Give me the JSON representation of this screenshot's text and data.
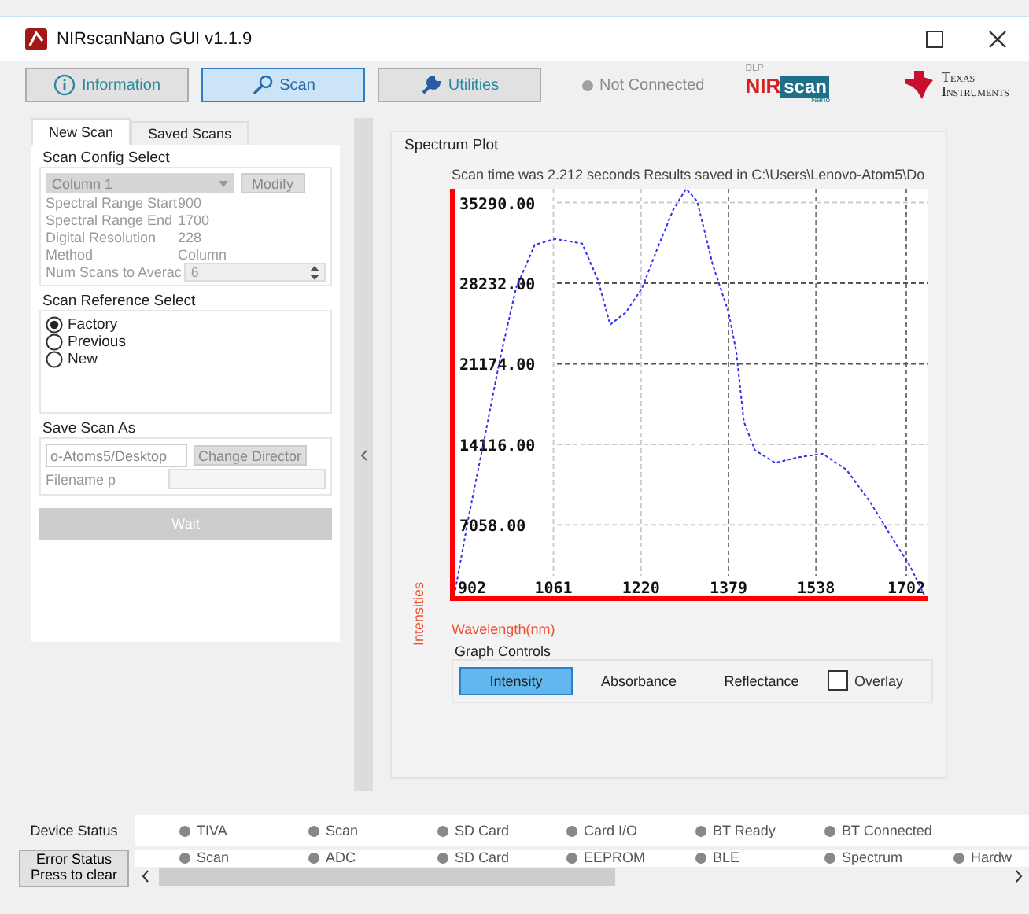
{
  "window": {
    "title": "NIRscanNano GUI v1.1.9"
  },
  "main_tabs": [
    {
      "label": "Information",
      "selected": false
    },
    {
      "label": "Scan",
      "selected": true
    },
    {
      "label": "Utilities",
      "selected": false
    }
  ],
  "connection": {
    "label": "Not Connected",
    "connected": false
  },
  "nirscan_logo": {
    "top": "DLP",
    "nir": "NIR",
    "scan": "scan",
    "sub": "Nano"
  },
  "ti_logo": {
    "line1": "Texas",
    "line2": "Instruments"
  },
  "scan_tabs": [
    {
      "label": "New Scan",
      "selected": true
    },
    {
      "label": "Saved Scans",
      "selected": false
    }
  ],
  "scan_config": {
    "title": "Scan Config Select",
    "disabled": true,
    "config": "Column 1",
    "modify": "Modify",
    "fields": [
      {
        "label": "Spectral Range Start",
        "value": "900"
      },
      {
        "label": "Spectral Range End",
        "value": "1700"
      },
      {
        "label": "Digital Resolution",
        "value": "228"
      },
      {
        "label": "Method",
        "value": "Column"
      }
    ],
    "num_scans": {
      "label": "Num Scans to Averac",
      "value": "6"
    }
  },
  "scan_reference": {
    "title": "Scan Reference Select",
    "options": [
      {
        "label": "Factory",
        "selected": true
      },
      {
        "label": "Previous",
        "selected": false
      },
      {
        "label": "New",
        "selected": false
      }
    ]
  },
  "save_scan": {
    "title": "Save Scan As",
    "directory": "o-Atoms5/Desktop",
    "change_button": "Change Director",
    "filename_label": "Filename p"
  },
  "scan_button": {
    "label": "Wait",
    "disabled": true
  },
  "spectrum": {
    "title": "Spectrum Plot",
    "message": "Scan time was 2.212 seconds Results saved in C:\\Users\\Lenovo-Atom5\\Do",
    "chart_data": {
      "type": "line",
      "xlabel": "Wavelength(nm)",
      "ylabel": "Intensities",
      "x": [
        879,
        907,
        936,
        964,
        993,
        1027,
        1064,
        1113,
        1142,
        1164,
        1193,
        1222,
        1250,
        1279,
        1302,
        1322,
        1350,
        1379,
        1393,
        1407,
        1427,
        1464,
        1507,
        1550,
        1593,
        1636,
        1679,
        1707,
        1736
      ],
      "series": [
        {
          "color": "#3333ee",
          "line_style": "dashed",
          "values": [
            400,
            7800,
            14700,
            21600,
            27800,
            31600,
            32100,
            31700,
            28500,
            24600,
            25700,
            27800,
            31300,
            34700,
            36500,
            35400,
            29900,
            25700,
            22300,
            16100,
            13600,
            12500,
            13000,
            13300,
            11900,
            9100,
            5700,
            3600,
            800
          ]
        }
      ],
      "grid": true,
      "xlim": [
        873,
        1742
      ],
      "ylim": [
        400,
        36500
      ],
      "xticks": [
        902,
        1061,
        1220,
        1379,
        1538,
        1702
      ],
      "yticks": [
        {
          "value": 7058,
          "label": "7058.00"
        },
        {
          "value": 14116,
          "label": "14116.00"
        },
        {
          "value": 21174,
          "label": "21174.00"
        },
        {
          "value": 28232,
          "label": "28232.00"
        },
        {
          "value": 35290,
          "label": "35290.00"
        }
      ]
    }
  },
  "graph_controls": {
    "title": "Graph Controls",
    "modes": [
      {
        "label": "Intensity",
        "selected": true
      },
      {
        "label": "Absorbance",
        "selected": false
      },
      {
        "label": "Reflectance",
        "selected": false
      }
    ],
    "overlay": {
      "label": "Overlay",
      "checked": false
    }
  },
  "device_status": {
    "label": "Device Status",
    "items": [
      {
        "label": "TIVA",
        "on": false
      },
      {
        "label": "Scan",
        "on": false
      },
      {
        "label": "SD Card",
        "on": false
      },
      {
        "label": "Card I/O",
        "on": false
      },
      {
        "label": "BT Ready",
        "on": false
      },
      {
        "label": "BT Connected",
        "on": false
      }
    ]
  },
  "error_status": {
    "button_lines": [
      "Error Status",
      "Press to clear"
    ],
    "items": [
      {
        "label": "Scan",
        "on": false
      },
      {
        "label": "ADC",
        "on": false
      },
      {
        "label": "SD Card",
        "on": false
      },
      {
        "label": "EEPROM",
        "on": false
      },
      {
        "label": "BLE",
        "on": false
      },
      {
        "label": "Spectrum",
        "on": false
      },
      {
        "label": "Hardw",
        "on": false
      }
    ]
  }
}
